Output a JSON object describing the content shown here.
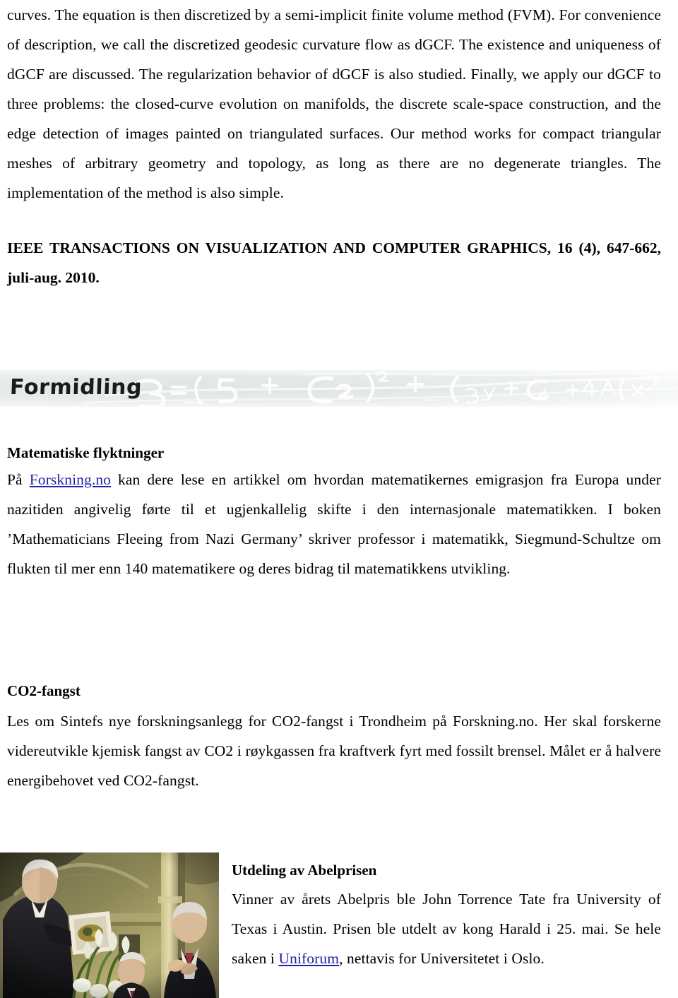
{
  "document": {
    "abstract_paragraph": "curves. The equation is then discretized by a semi-implicit finite volume method (FVM). For convenience of description, we call the discretized geodesic curvature flow as dGCF. The existence and uniqueness of dGCF are discussed. The regularization behavior of dGCF is also studied. Finally, we apply our dGCF to three problems: the closed-curve evolution on manifolds, the discrete scale-space construction, and the edge detection of images painted on triangulated surfaces. Our method works for compact triangular meshes of arbitrary geometry and topology, as long as there are no degenerate triangles. The implementation of the method is also simple.",
    "citation": "IEEE TRANSACTIONS ON VISUALIZATION AND COMPUTER GRAPHICS, 16 (4), 647-662, juli-aug. 2010."
  },
  "banner": {
    "title": "Formidling",
    "background_color": "#e2e7e7",
    "scribble_color": "#ffffff"
  },
  "sections": [
    {
      "id": "matematiske-flyktninger",
      "heading": "Matematiske flyktninger",
      "body_before_link": "På ",
      "link_text": "Forskning.no",
      "body_after_link": " kan dere lese en artikkel om hvordan matematikernes emigrasjon fra Europa under nazitiden angivelig førte til et ugjenkallelig skifte i den internasjonale matematikken. I boken ’Mathematicians Fleeing from Nazi Germany’ skriver professor i matematikk, Siegmund-Schultze om flukten til mer enn 140 matematikere og deres bidrag til matematikkens utvikling."
    },
    {
      "id": "co2-fangst",
      "heading": "CO2-fangst",
      "body": "Les om Sintefs nye forskningsanlegg for CO2-fangst i Trondheim på Forskning.no. Her skal forskerne videreutvikle kjemisk fangst av CO2 i røykgassen fra kraftverk fyrt med fossilt brensel. Målet er å halvere energibehovet ved CO2-fangst."
    },
    {
      "id": "utdeling-av-abelprisen",
      "heading": "Utdeling av Abelprisen",
      "body_before_link": "Vinner av årets Abelpris ble John Torrence Tate fra University of Texas i Austin. Prisen ble utdelt av kong Harald i 25. mai. Se hele saken i ",
      "link_text": "Uniforum",
      "body_after_link": ", nettavis for Universitetet i Oslo."
    }
  ],
  "photo": {
    "caption_alt": "abelprisen-ceremony-photo"
  },
  "colors": {
    "link": "#2222a8",
    "text": "#000000",
    "background": "#ffffff"
  }
}
